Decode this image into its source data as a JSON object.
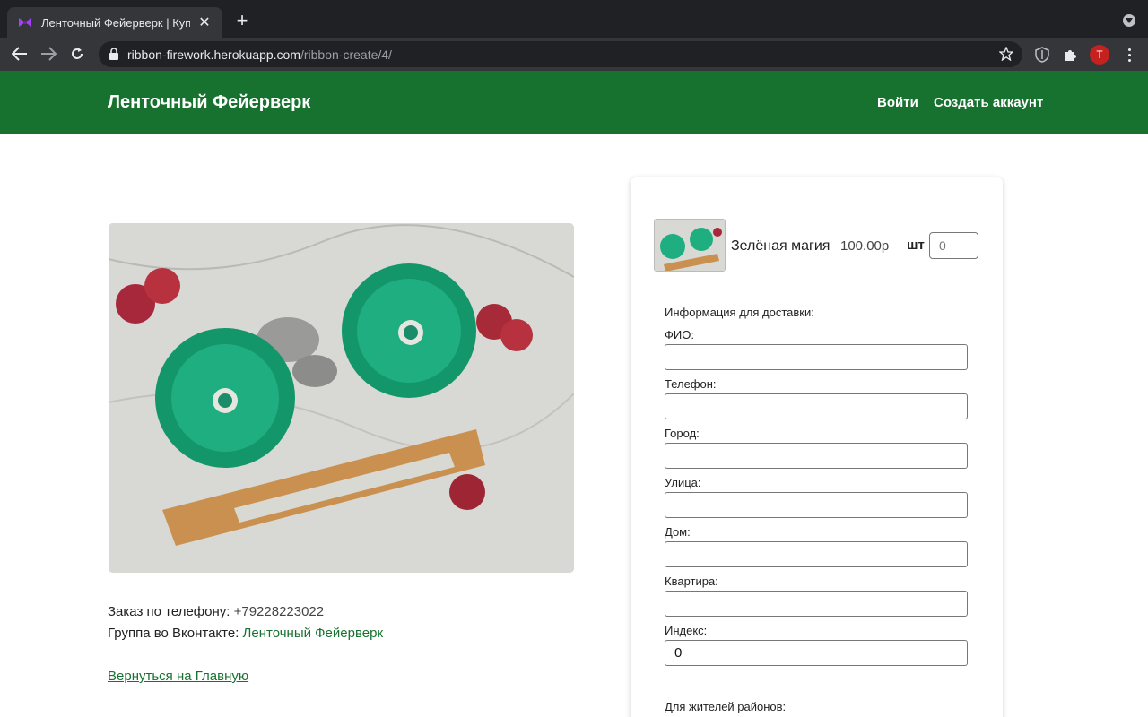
{
  "browser": {
    "tab_title": "Ленточный Фейерверк | Купи",
    "favicon": "bow-icon",
    "url_host": "ribbon-firework.herokuapp.com",
    "url_path": "/ribbon-create/4/",
    "profile_initial": "T"
  },
  "header": {
    "brand": "Ленточный Фейерверк",
    "login": "Войти",
    "signup": "Создать аккаунт"
  },
  "contact": {
    "phone_label": "Заказ по телефону:",
    "phone_value": "+79228223022",
    "vk_label": "Группа во Вконтакте:",
    "vk_link": "Ленточный Фейерверк",
    "back_link": "Вернуться на Главную"
  },
  "order": {
    "product_name": "Зелёная магия",
    "price": "100.00р",
    "unit": "шт",
    "quantity_placeholder": "0",
    "form_heading": "Информация для доставки:",
    "fields": [
      {
        "label": "ФИО:",
        "value": ""
      },
      {
        "label": "Телефон:",
        "value": ""
      },
      {
        "label": "Город:",
        "value": ""
      },
      {
        "label": "Улица:",
        "value": ""
      },
      {
        "label": "Дом:",
        "value": ""
      },
      {
        "label": "Квартира:",
        "value": ""
      },
      {
        "label": "Индекс:",
        "value": "0"
      }
    ],
    "district_label": "Для жителей районов:"
  },
  "colors": {
    "brand_green": "#17722f",
    "ribbon_green": "#1fae80"
  }
}
